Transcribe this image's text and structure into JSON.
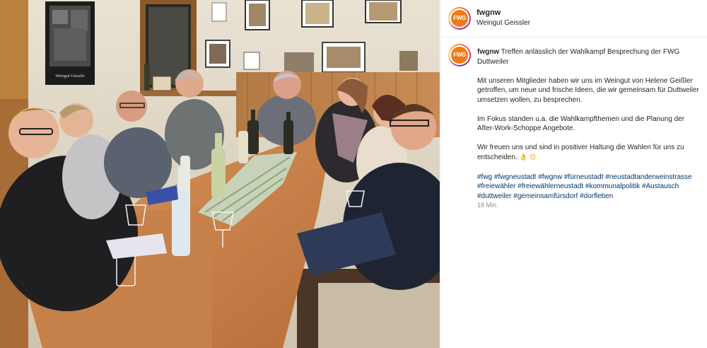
{
  "post": {
    "username": "fwgnw",
    "location": "Weingut Geissler",
    "avatar_text": "FWG",
    "avatar_color": "#f07a1a"
  },
  "caption": {
    "username": "fwgnw",
    "title": "Treffen anlässlich der Wahlkampf Besprechung der FWG Duttweiler",
    "paragraph1": "Mit unseren Mitglieder haben wir uns im Weingut von Helene Geißler getroffen, um neue und frische Ideen, die wir gemeinsam für Duttweiler umsetzen wollen, zu besprechen.",
    "paragraph2": "Im Fokus standen u.a. die Wahlkampfthemen und die Planung der After-Work-Schoppe Angebote.",
    "paragraph3": "Wir freuen uns und sind in positiver Haltung die Wahlen für uns zu entscheiden.",
    "emojis": "👌 😊",
    "hashtags": [
      "#fwg",
      "#fwgneustadt",
      "#fwgnw",
      "#fürneustadt",
      "#neustadtanderweinstrasse",
      "#freiewähler",
      "#freiewählerneustadt",
      "#kommunalpolitik",
      "#Austausch",
      "#duttweiler",
      "#gemeinsamfürsdorf",
      "#dorfleben"
    ],
    "time": "18 Min."
  },
  "photo": {
    "poster_text": "Weingut Geissler"
  },
  "colors": {
    "link": "#00376b",
    "muted": "#8e8e8e",
    "border": "#efefef"
  }
}
